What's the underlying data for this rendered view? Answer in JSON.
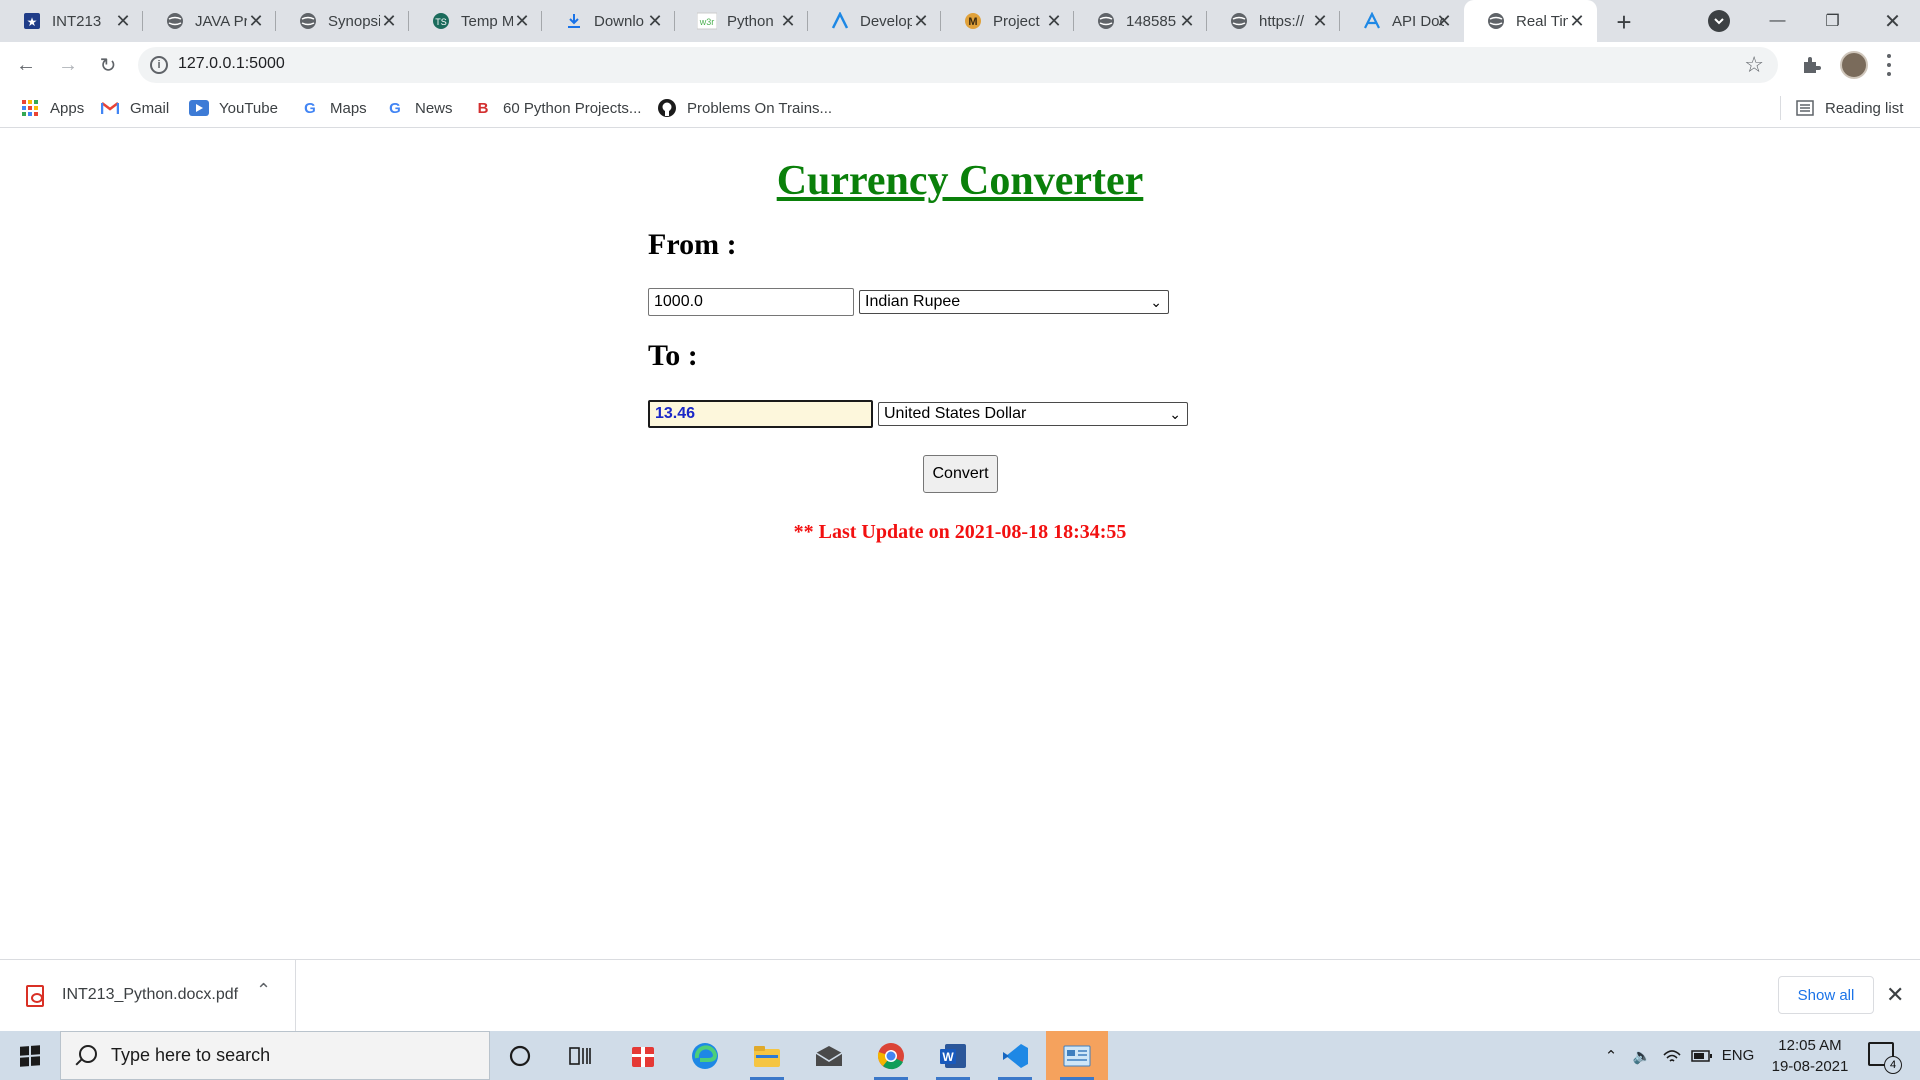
{
  "browser": {
    "tabs": [
      {
        "title": "INT213",
        "icon": "star-shield-icon"
      },
      {
        "title": "JAVA Pr",
        "icon": "globe-icon"
      },
      {
        "title": "Synopsi",
        "icon": "globe-icon"
      },
      {
        "title": "Temp M",
        "icon": "logo-icon"
      },
      {
        "title": "Downlo",
        "icon": "download-icon"
      },
      {
        "title": "Python",
        "icon": "w3schools-icon"
      },
      {
        "title": "Develop",
        "icon": "logo-icon"
      },
      {
        "title": "Project",
        "icon": "logo-m-icon"
      },
      {
        "title": "148585",
        "icon": "globe-icon"
      },
      {
        "title": "https://",
        "icon": "globe-icon"
      },
      {
        "title": "API Doc",
        "icon": "logo-icon"
      },
      {
        "title": "Real Tin",
        "icon": "globe-icon"
      }
    ],
    "active_tab_index": 11,
    "url": "127.0.0.1:5000",
    "bookmarks": [
      {
        "label": "Apps",
        "icon": "apps-grid-icon"
      },
      {
        "label": "Gmail",
        "icon": "gmail-icon"
      },
      {
        "label": "YouTube",
        "icon": "youtube-icon"
      },
      {
        "label": "Maps",
        "icon": "google-icon"
      },
      {
        "label": "News",
        "icon": "google-icon"
      },
      {
        "label": "60 Python Projects...",
        "icon": "b-logo-icon"
      },
      {
        "label": "Problems On Trains...",
        "icon": "github-icon"
      }
    ],
    "reading_list": "Reading list"
  },
  "page": {
    "title": "Currency Converter",
    "from_label": "From :",
    "to_label": "To :",
    "from_amount": "1000.0",
    "from_currency": "Indian Rupee",
    "to_amount": "13.46",
    "to_currency": "United States Dollar",
    "convert_label": "Convert",
    "last_update": "** Last Update on 2021-08-18 18:34:55"
  },
  "downloads": {
    "file_name": "INT213_Python.docx.pdf",
    "show_all": "Show all"
  },
  "taskbar": {
    "search_placeholder": "Type here to search",
    "language": "ENG",
    "time": "12:05 AM",
    "date": "19-08-2021",
    "notification_count": "4"
  },
  "colors": {
    "title_green": "#0a800a",
    "update_red": "#f21010",
    "result_bg": "#fdf7dc",
    "result_text": "#1a27c7"
  }
}
